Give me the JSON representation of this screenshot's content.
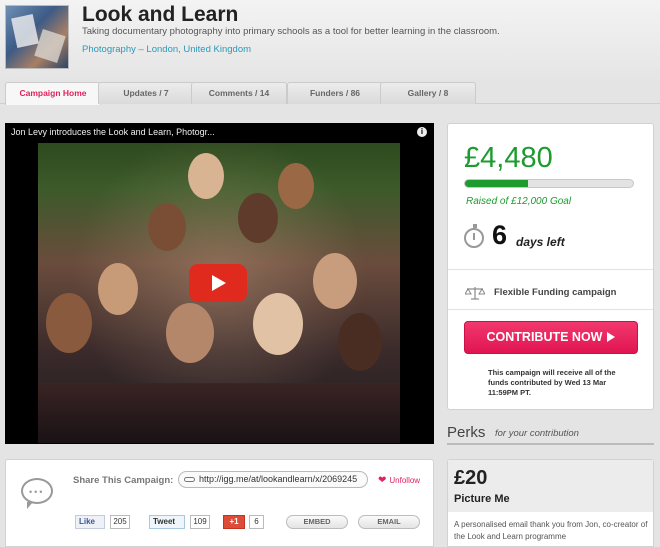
{
  "campaign": {
    "title": "Look and Learn",
    "tagline": "Taking documentary photography into primary schools as a tool for better learning in the classroom.",
    "category_location": "Photography – London, United Kingdom"
  },
  "tabs": [
    {
      "label": "Campaign Home",
      "active": true
    },
    {
      "label": "Updates / 7",
      "active": false
    },
    {
      "label": "Comments / 14",
      "active": false
    },
    {
      "label": "Funders / 86",
      "active": false
    },
    {
      "label": "Gallery / 8",
      "active": false
    }
  ],
  "video": {
    "title": "Jon Levy introduces the Look and Learn, Photogr...",
    "info_icon": "i"
  },
  "funding": {
    "amount": "£4,480",
    "progress_fraction": 0.373,
    "goal_text": "Raised of £12,000 Goal",
    "days_number": "6",
    "days_label": "days left",
    "funding_type": "Flexible Funding campaign",
    "contribute_label": "CONTRIBUTE NOW",
    "note": "This campaign will receive all of the funds contributed by Wed 13 Mar 11:59PM PT."
  },
  "perks": {
    "title": "Perks",
    "subtitle": "for your contribution",
    "first": {
      "price": "£20",
      "name": "Picture Me",
      "description": "A personalised email thank you from Jon, co-creator of the Look and Learn programme"
    }
  },
  "share": {
    "label": "Share This Campaign:",
    "url": "http://igg.me/at/lookandlearn/x/2069245",
    "unfollow_label": "Unfollow",
    "fb_like_label": "Like",
    "fb_count": "205",
    "tweet_label": "Tweet",
    "tweet_count": "109",
    "gplus_label": "+1",
    "gplus_count": "6",
    "embed_label": "EMBED",
    "email_label": "EMAIL"
  },
  "colors": {
    "accent_pink": "#e0225d",
    "funding_green": "#1d9b2e",
    "link_blue": "#2b9ab8"
  }
}
